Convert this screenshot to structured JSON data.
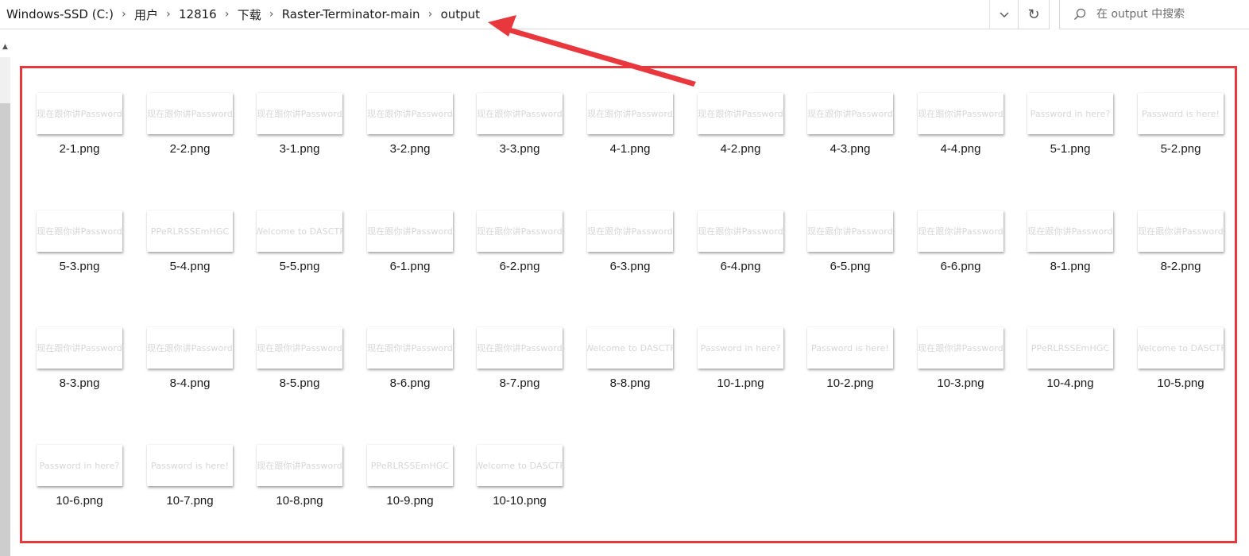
{
  "breadcrumb": {
    "items": [
      {
        "label": "Windows-SSD (C:)"
      },
      {
        "label": "用户"
      },
      {
        "label": "12816"
      },
      {
        "label": "下载"
      },
      {
        "label": "Raster-Terminator-main"
      },
      {
        "label": "output"
      }
    ],
    "separator": "›"
  },
  "toolbar": {
    "dropdown_icon": "chevron-down-icon",
    "refresh_icon": "refresh-icon",
    "refresh_glyph": "↻"
  },
  "search": {
    "placeholder": "在 output 中搜索",
    "icon": "search-icon"
  },
  "scroll": {
    "up_glyph": "▲"
  },
  "annotation": {
    "color": "#e8383d"
  },
  "files": [
    {
      "name": "2-1.png",
      "thumb_text": "现在跟你讲Password"
    },
    {
      "name": "2-2.png",
      "thumb_text": "现在跟你讲Password"
    },
    {
      "name": "3-1.png",
      "thumb_text": "现在跟你讲Password"
    },
    {
      "name": "3-2.png",
      "thumb_text": "现在跟你讲Password"
    },
    {
      "name": "3-3.png",
      "thumb_text": "现在跟你讲Password"
    },
    {
      "name": "4-1.png",
      "thumb_text": "现在跟你讲Password"
    },
    {
      "name": "4-2.png",
      "thumb_text": "现在跟你讲Password"
    },
    {
      "name": "4-3.png",
      "thumb_text": "现在跟你讲Password"
    },
    {
      "name": "4-4.png",
      "thumb_text": "现在跟你讲Password"
    },
    {
      "name": "5-1.png",
      "thumb_text": "Password in here?"
    },
    {
      "name": "5-2.png",
      "thumb_text": "Password is here!"
    },
    {
      "name": "5-3.png",
      "thumb_text": "现在跟你讲Password"
    },
    {
      "name": "5-4.png",
      "thumb_text": "PPeRLRSSEmHGC"
    },
    {
      "name": "5-5.png",
      "thumb_text": "Welcome to DASCTF"
    },
    {
      "name": "6-1.png",
      "thumb_text": "现在跟你讲Password"
    },
    {
      "name": "6-2.png",
      "thumb_text": "现在跟你讲Password"
    },
    {
      "name": "6-3.png",
      "thumb_text": "现在跟你讲Password"
    },
    {
      "name": "6-4.png",
      "thumb_text": "现在跟你讲Password"
    },
    {
      "name": "6-5.png",
      "thumb_text": "现在跟你讲Password"
    },
    {
      "name": "6-6.png",
      "thumb_text": "现在跟你讲Password"
    },
    {
      "name": "8-1.png",
      "thumb_text": "现在跟你讲Password"
    },
    {
      "name": "8-2.png",
      "thumb_text": "现在跟你讲Password"
    },
    {
      "name": "8-3.png",
      "thumb_text": "现在跟你讲Password"
    },
    {
      "name": "8-4.png",
      "thumb_text": "现在跟你讲Password"
    },
    {
      "name": "8-5.png",
      "thumb_text": "现在跟你讲Password"
    },
    {
      "name": "8-6.png",
      "thumb_text": "现在跟你讲Password"
    },
    {
      "name": "8-7.png",
      "thumb_text": "现在跟你讲Password"
    },
    {
      "name": "8-8.png",
      "thumb_text": "Welcome to DASCTF"
    },
    {
      "name": "10-1.png",
      "thumb_text": "Password in here?"
    },
    {
      "name": "10-2.png",
      "thumb_text": "Password is here!"
    },
    {
      "name": "10-3.png",
      "thumb_text": "现在跟你讲Password"
    },
    {
      "name": "10-4.png",
      "thumb_text": "PPeRLRSSEmHGC"
    },
    {
      "name": "10-5.png",
      "thumb_text": "Welcome to DASCTF"
    },
    {
      "name": "10-6.png",
      "thumb_text": "Password in here?"
    },
    {
      "name": "10-7.png",
      "thumb_text": "Password is here!"
    },
    {
      "name": "10-8.png",
      "thumb_text": "现在跟你讲Password"
    },
    {
      "name": "10-9.png",
      "thumb_text": "PPeRLRSSEmHGC"
    },
    {
      "name": "10-10.png",
      "thumb_text": "Welcome to DASCTF"
    }
  ]
}
